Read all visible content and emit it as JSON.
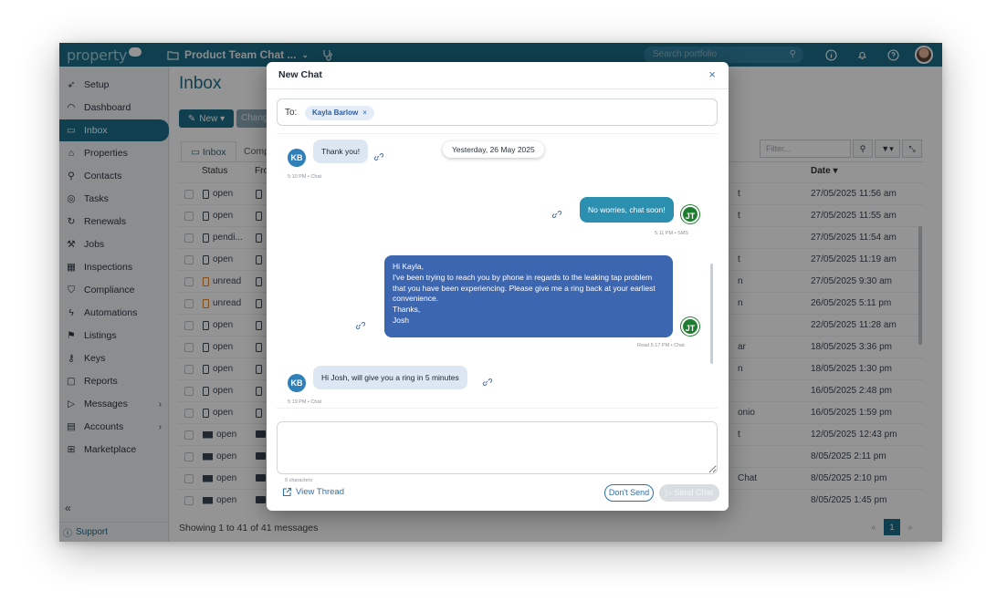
{
  "app": {
    "logo": "property",
    "workspace": "Product Team Chat ...",
    "search_placeholder": "Search portfolio"
  },
  "sidebar": {
    "items": [
      {
        "label": "Setup",
        "icon": "rocket-icon"
      },
      {
        "label": "Dashboard",
        "icon": "gauge-icon"
      },
      {
        "label": "Inbox",
        "icon": "inbox-icon",
        "active": true
      },
      {
        "label": "Properties",
        "icon": "house-icon"
      },
      {
        "label": "Contacts",
        "icon": "person-icon"
      },
      {
        "label": "Tasks",
        "icon": "check-circle-icon"
      },
      {
        "label": "Renewals",
        "icon": "refresh-icon"
      },
      {
        "label": "Jobs",
        "icon": "wrench-icon"
      },
      {
        "label": "Inspections",
        "icon": "calendar-icon"
      },
      {
        "label": "Compliance",
        "icon": "shield-icon"
      },
      {
        "label": "Automations",
        "icon": "bolt-icon"
      },
      {
        "label": "Listings",
        "icon": "sign-icon"
      },
      {
        "label": "Keys",
        "icon": "key-icon"
      },
      {
        "label": "Reports",
        "icon": "folder-icon"
      },
      {
        "label": "Messages",
        "icon": "send-icon",
        "chevron": "›"
      },
      {
        "label": "Accounts",
        "icon": "ledger-icon",
        "chevron": "›"
      },
      {
        "label": "Marketplace",
        "icon": "grid-icon"
      }
    ],
    "collapse": "«",
    "support": "Support"
  },
  "inbox": {
    "title": "Inbox",
    "new_button": "New ▾",
    "change_button": "Chang",
    "tab_inbox": "Inbox",
    "tab_comp": "Comp",
    "filter_placeholder": "Filter...",
    "col_status": "Status",
    "col_from": "Fro",
    "col_date": "Date ▾",
    "rows": [
      {
        "status": "open",
        "frag": "t",
        "date": "27/05/2025 11:56 am"
      },
      {
        "status": "open",
        "frag": "t",
        "date": "27/05/2025 11:55 am"
      },
      {
        "status": "pendi...",
        "frag": "",
        "date": "27/05/2025 11:54 am"
      },
      {
        "status": "open",
        "frag": "t",
        "date": "27/05/2025 11:19 am"
      },
      {
        "status": "unread",
        "frag": "n",
        "date": "27/05/2025 9:30 am"
      },
      {
        "status": "unread",
        "frag": "n",
        "date": "26/05/2025 5:11 pm"
      },
      {
        "status": "open",
        "frag": "",
        "date": "22/05/2025 11:28 am"
      },
      {
        "status": "open",
        "frag": "ar",
        "date": "18/05/2025 3:36 pm"
      },
      {
        "status": "open",
        "frag": "n",
        "date": "18/05/2025 1:30 pm"
      },
      {
        "status": "open",
        "frag": "",
        "date": "16/05/2025 2:48 pm"
      },
      {
        "status": "open",
        "frag": "onio",
        "date": "16/05/2025 1:59 pm"
      },
      {
        "status": "open",
        "frag": "t",
        "date": "12/05/2025 12:43 pm"
      },
      {
        "status": "open",
        "frag": "",
        "date": "8/05/2025 2:11 pm"
      },
      {
        "status": "open",
        "frag": "Chat",
        "date": "8/05/2025 2:10 pm"
      },
      {
        "status": "open",
        "frag": "",
        "date": "8/05/2025 1:45 pm"
      }
    ],
    "showing": "Showing 1 to 41 of 41 messages",
    "pager": {
      "prev": "«",
      "current": "1",
      "next": "»"
    }
  },
  "modal": {
    "title": "New Chat",
    "close": "×",
    "to_label": "To:",
    "recipient": "Kayla Barlow",
    "recipient_remove": "×",
    "date_separator": "Yesterday, 26 May 2025",
    "messages": [
      {
        "initials": "KB",
        "text": "Thank you!",
        "meta": "5:10 PM • Chat"
      },
      {
        "initials": "JT",
        "text": "No worries, chat soon!",
        "meta": "5:11 PM • SMS"
      },
      {
        "initials": "JT",
        "lines": [
          "Hi Kayla,",
          "I've been trying to reach you by phone in regards to the leaking tap problem",
          "that you have been experiencing. Please give me a ring back at your earliest",
          "convenience.",
          "Thanks,",
          "Josh"
        ],
        "meta": "Read 5:17 PM • Chat"
      },
      {
        "initials": "KB",
        "text": "Hi Josh, will give you a ring in 5 minutes",
        "meta": "5:19 PM • Chat"
      }
    ],
    "char_count": "0 characters",
    "view_thread": "View Thread",
    "dont_send": "Don't Send",
    "send_chat": "Send Chat"
  },
  "colors": {
    "brand": "#1d6d89",
    "incoming_bubble": "#dde6f3",
    "sms_bubble": "#2b8fb0",
    "chat_bubble": "#3d66b1",
    "kb_avatar": "#2f80b9",
    "jt_avatar": "#1e7d2f"
  }
}
